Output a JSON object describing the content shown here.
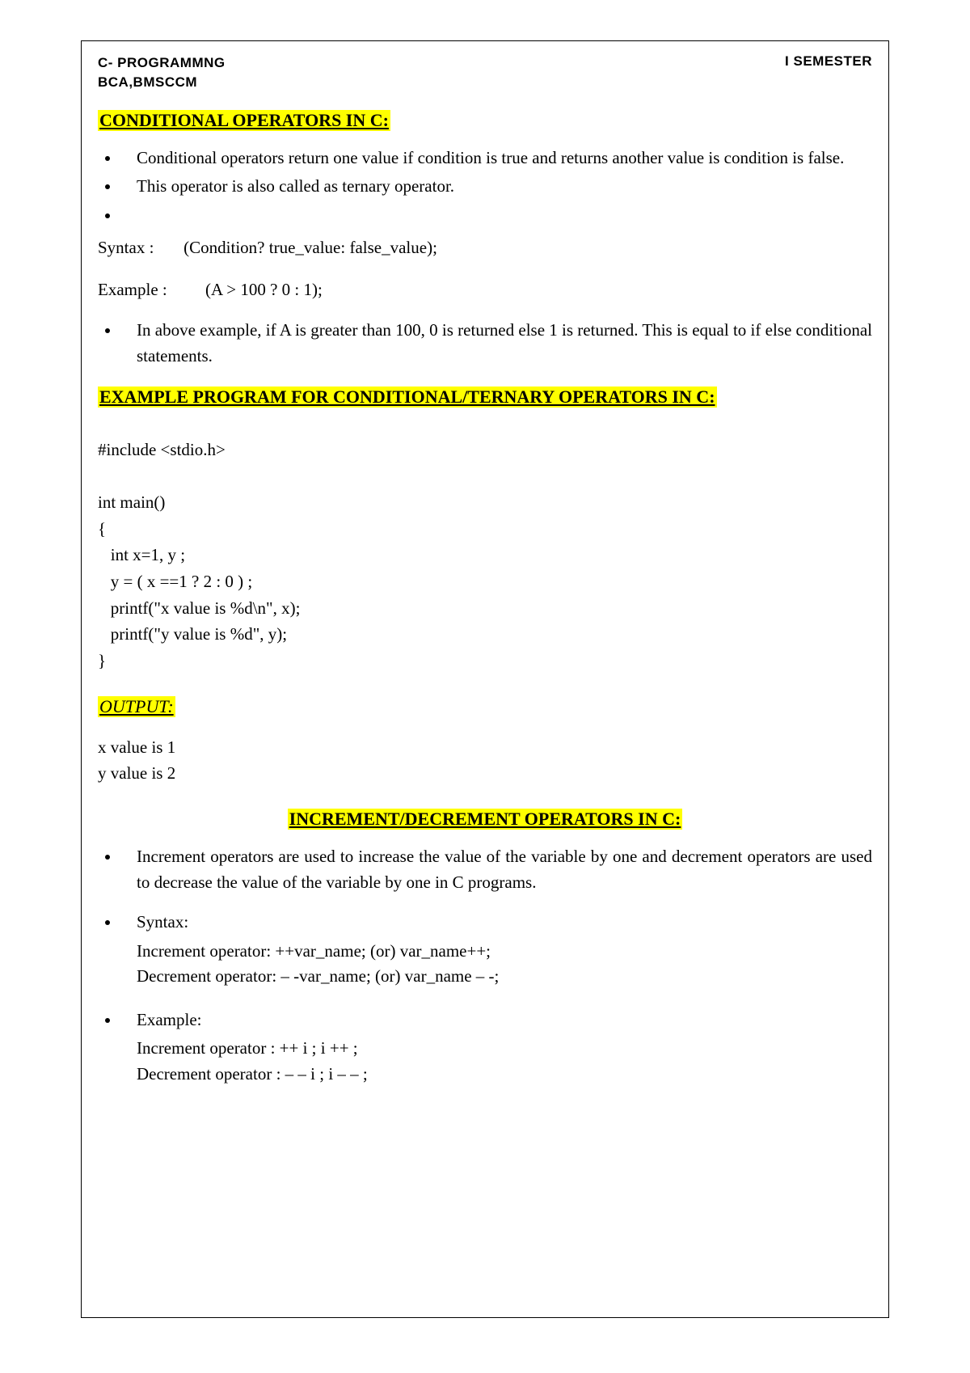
{
  "header": {
    "left_line1": "C- PROGRAMMNG",
    "left_line2": "BCA,BMSCCM",
    "right": "I SEMESTER"
  },
  "section1": {
    "heading": "CONDITIONAL OPERATORS IN C:",
    "bullet1": "Conditional operators return one value if condition is true and returns another value is condition is false.",
    "bullet2": "This operator is also called as ternary operator.",
    "syntax_label": "Syntax     :",
    "syntax_value": "(Condition? true_value: false_value);",
    "example_label": "Example :",
    "example_value": "(A > 100  ?  0  :  1);",
    "bullet3": "In above example, if A is greater than 100, 0 is returned else 1 is returned. This is equal to if else conditional statements."
  },
  "section2": {
    "heading": "EXAMPLE PROGRAM FOR CONDITIONAL/TERNARY OPERATORS IN C:",
    "code": "#include <stdio.h>\n\nint main()\n{\n   int x=1, y ;\n   y = ( x ==1 ? 2 : 0 ) ;\n   printf(\"x value is %d\\n\", x);\n   printf(\"y value is %d\", y);\n}",
    "output_label": "OUTPUT:",
    "output_line1": "x value is 1",
    "output_line2": "y value is 2"
  },
  "section3": {
    "heading": "INCREMENT/DECREMENT OPERATORS IN C:",
    "bullet1": "Increment operators are used to increase the value of the variable by one and decrement operators are used to decrease the value of the variable by one in C programs.",
    "syntax_label": "Syntax:",
    "syntax_inc": "Increment operator: ++var_name; (or) var_name++;",
    "syntax_dec": "Decrement operator: – -var_name; (or) var_name – -;",
    "example_label": "Example:",
    "example_inc": "Increment operator :  ++ i ;    i ++ ;",
    "example_dec": "Decrement operator :  – – i ;   i – – ;"
  }
}
